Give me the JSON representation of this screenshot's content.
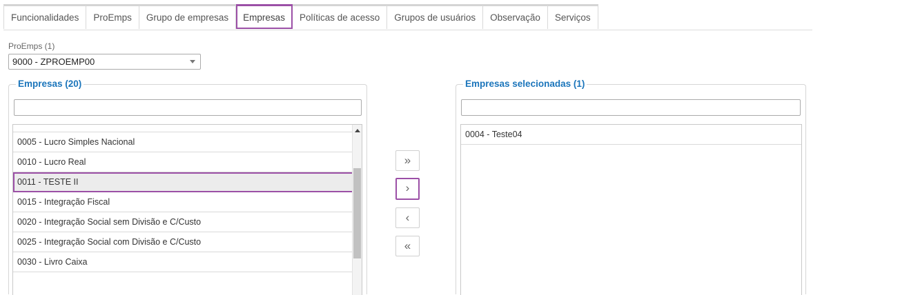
{
  "tabs": [
    {
      "label": "Funcionalidades"
    },
    {
      "label": "ProEmps"
    },
    {
      "label": "Grupo de empresas"
    },
    {
      "label": "Empresas"
    },
    {
      "label": "Políticas de acesso"
    },
    {
      "label": "Grupos de usuários"
    },
    {
      "label": "Observação"
    },
    {
      "label": "Serviços"
    }
  ],
  "active_tab": "Empresas",
  "proemps": {
    "label": "ProEmps (1)",
    "selected": "9000 - ZPROEMP00"
  },
  "available": {
    "title": "Empresas (20)",
    "filter_value": "",
    "items": [
      {
        "label": "0005 - Lucro Simples Nacional"
      },
      {
        "label": "0010 - Lucro Real"
      },
      {
        "label": "0011 - TESTE II"
      },
      {
        "label": "0015 - Integração Fiscal"
      },
      {
        "label": "0020 - Integração Social sem Divisão e C/Custo"
      },
      {
        "label": "0025 - Integração Social com Divisão e C/Custo"
      },
      {
        "label": "0030 - Livro Caixa"
      }
    ],
    "selected_item": "0011 - TESTE II"
  },
  "selected": {
    "title": "Empresas selecionadas (1)",
    "filter_value": "",
    "items": [
      {
        "label": "0004 - Teste04"
      }
    ]
  },
  "buttons": {
    "add_all": "»",
    "add": "›",
    "remove": "‹",
    "remove_all": "«"
  },
  "colors": {
    "accent_highlight": "#9b4fa6",
    "title_blue": "#1b75bb"
  }
}
